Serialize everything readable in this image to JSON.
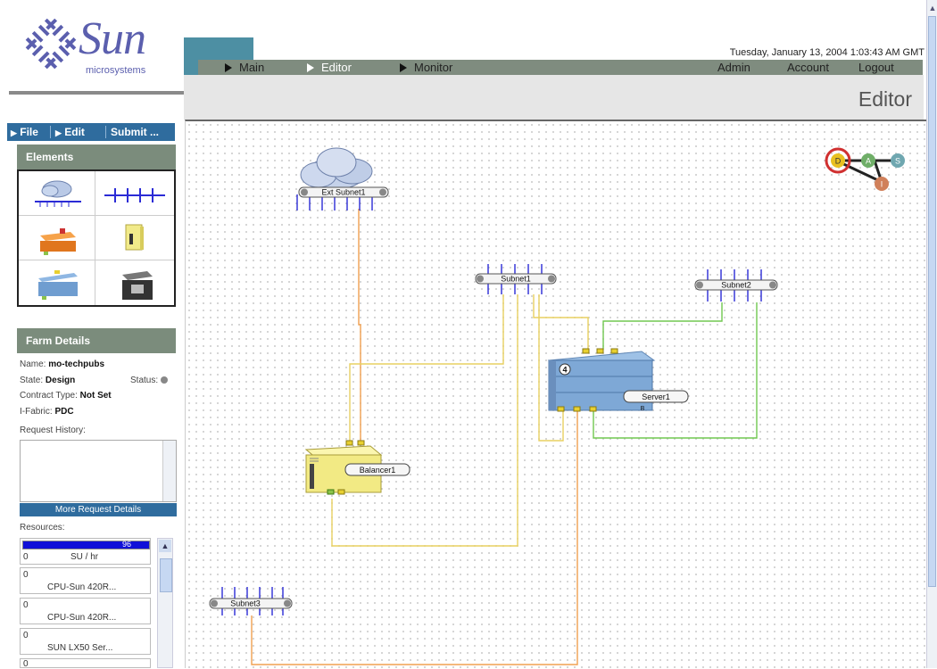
{
  "header": {
    "brand": "Sun",
    "brand_sub": "microsystems",
    "datetime": "Tuesday, January 13, 2004 1:03:43 AM GMT",
    "nav": [
      "Main",
      "Editor",
      "Monitor"
    ],
    "nav_right": [
      "Admin",
      "Account",
      "Logout"
    ],
    "page_title": "Editor"
  },
  "toolbar": {
    "file": "File",
    "edit": "Edit",
    "submit": "Submit ..."
  },
  "elements_panel": {
    "title": "Elements",
    "items": [
      "subnet-cloud",
      "subnet-bus",
      "load-balancer",
      "firewall",
      "server",
      "storage"
    ]
  },
  "farm_details": {
    "title": "Farm Details",
    "name_label": "Name:",
    "name": "mo-techpubs",
    "state_label": "State:",
    "state": "Design",
    "status_label": "Status:",
    "contract_label": "Contract Type:",
    "contract": "Not Set",
    "ifabric_label": "I-Fabric:",
    "ifabric": "PDC",
    "request_history_label": "Request History:",
    "more_request_details": "More Request Details",
    "resources_label": "Resources:",
    "resources": [
      {
        "min": "0",
        "value": "96",
        "unit": "SU / hr"
      },
      {
        "min": "0",
        "name": "CPU-Sun 420R..."
      },
      {
        "min": "0",
        "name": "CPU-Sun 420R..."
      },
      {
        "min": "0",
        "name": "SUN LX50 Ser..."
      },
      {
        "min": "0",
        "name": ""
      }
    ]
  },
  "diagram": {
    "nodes": {
      "ext_subnet": "Ext Subnet1",
      "subnet1": "Subnet1",
      "subnet2": "Subnet2",
      "subnet3": "Subnet3",
      "server": "Server1",
      "server_count": "4",
      "server_badge": "B",
      "balancer": "Balancer1"
    },
    "mode_circles": [
      "D",
      "A",
      "S",
      "I"
    ]
  },
  "colors": {
    "nav_bg": "#7f8c7f",
    "teal": "#4d8fa3",
    "toolbar_blue": "#2f6c9e",
    "wire_orange": "#f0a050",
    "wire_yellow": "#e8d060",
    "wire_green": "#70c850",
    "subnet_blue": "#2b2bd6"
  }
}
